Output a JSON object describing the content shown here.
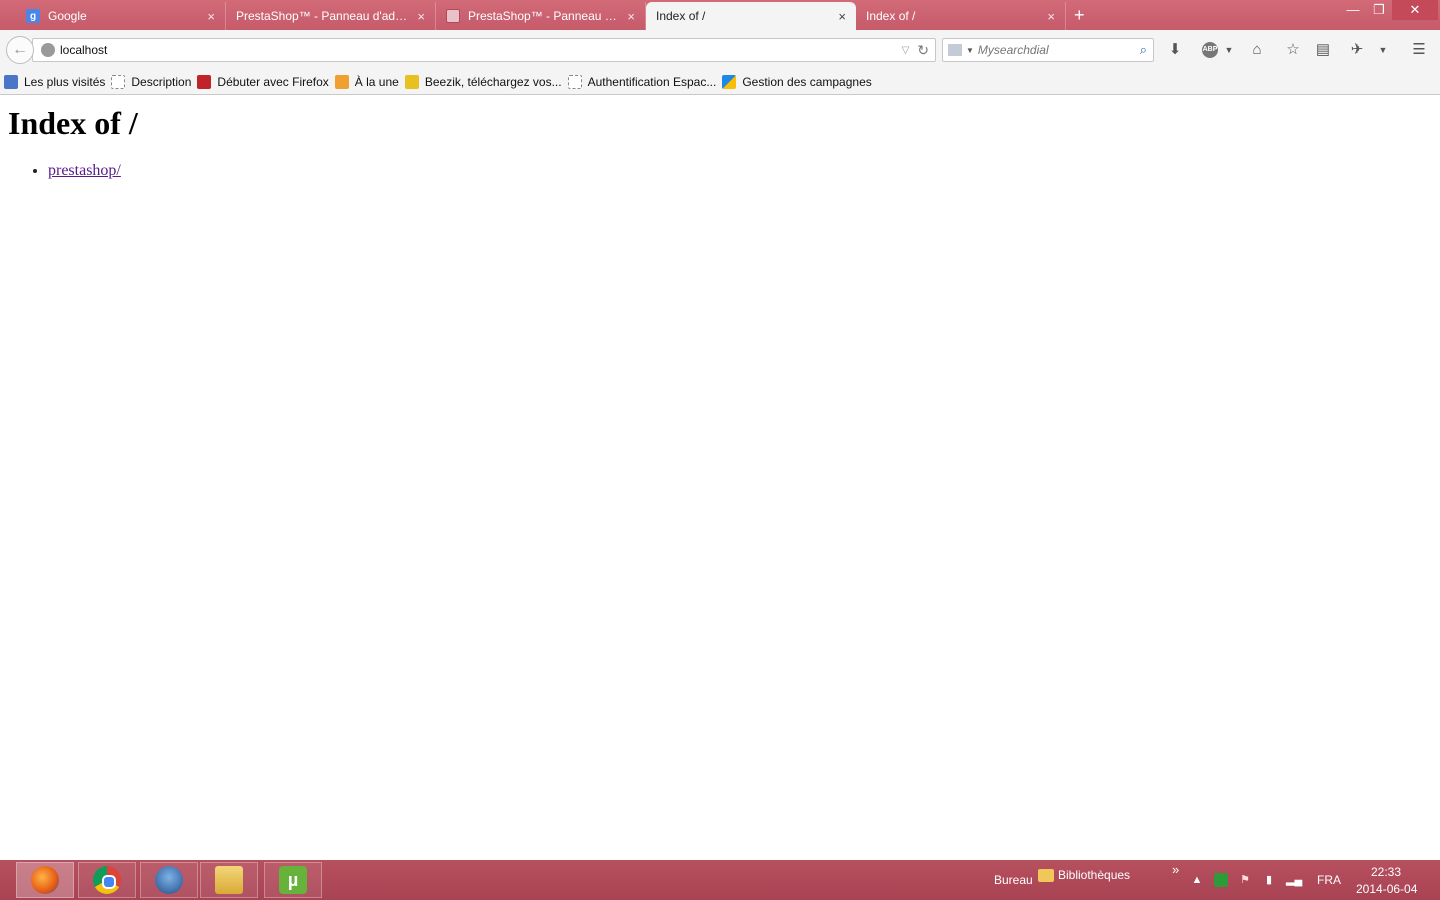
{
  "tabs": [
    {
      "label": "Google",
      "icon": "google-icon"
    },
    {
      "label": "PrestaShop™ - Panneau d'admi...",
      "icon": "page-icon"
    },
    {
      "label": "PrestaShop™ - Panneau d'...",
      "icon": "prestashop-icon"
    },
    {
      "label": "Index of /",
      "icon": "",
      "active": true
    },
    {
      "label": "Index of /",
      "icon": ""
    }
  ],
  "tab_close_glyph": "×",
  "new_tab_glyph": "+",
  "window": {
    "minimize": "—",
    "restore": "❐",
    "close": "✕"
  },
  "navbar": {
    "url": "localhost",
    "search_placeholder": "Mysearchdial"
  },
  "bookmarks": [
    {
      "label": "Les plus visités"
    },
    {
      "label": "Description"
    },
    {
      "label": "Débuter avec Firefox"
    },
    {
      "label": "À la une"
    },
    {
      "label": "Beezik, téléchargez vos..."
    },
    {
      "label": "Authentification Espac..."
    },
    {
      "label": "Gestion des campagnes"
    }
  ],
  "page": {
    "heading": "Index of /",
    "links": [
      "prestashop/"
    ]
  },
  "taskbar": {
    "apps": [
      "firefox",
      "chrome",
      "thunderbird",
      "explorer",
      "utorrent"
    ],
    "toolbar_label": "Bureau",
    "libraries_label": "Bibliothèques",
    "chevron": "»",
    "language": "FRA",
    "time": "22:33",
    "date": "2014-06-04"
  },
  "colors": {
    "titlebar": "#c65b6a",
    "taskbar": "#a84353",
    "visited_link": "#551a8b"
  }
}
